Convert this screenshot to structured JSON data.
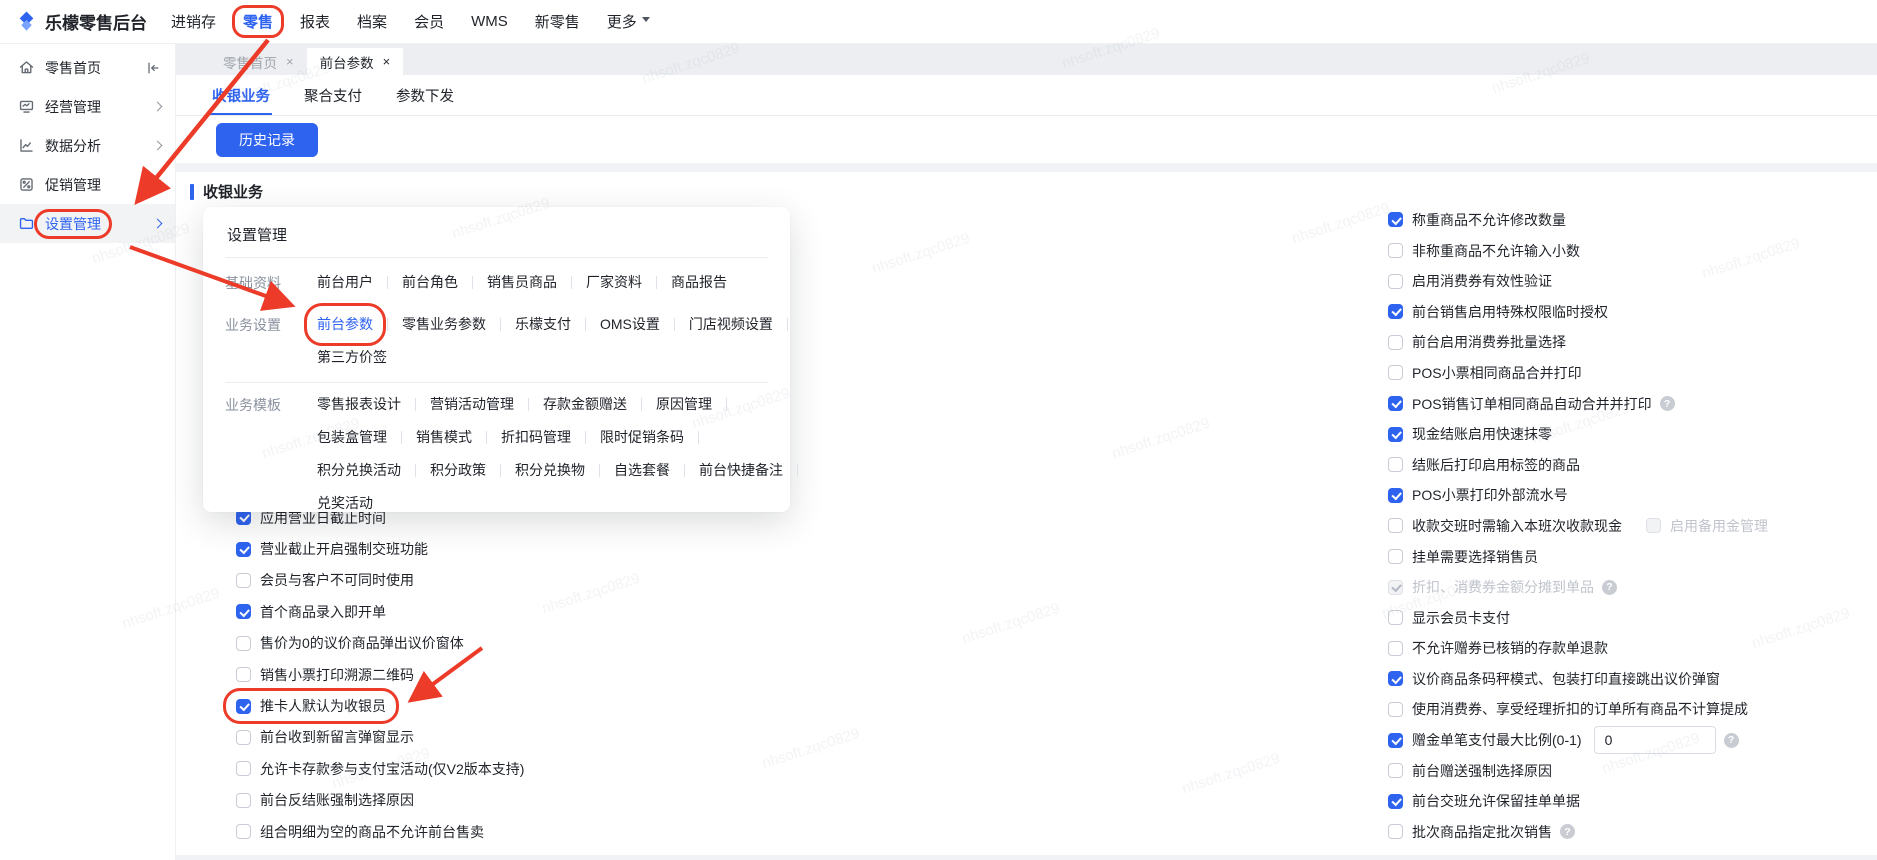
{
  "colors": {
    "accent": "#2e63f0",
    "annotation_red": "#ec3b28"
  },
  "watermark": "nhsoft.zqc0829",
  "topnav": {
    "brand": "乐檬零售后台",
    "items": [
      {
        "label": "进销存"
      },
      {
        "label": "零售",
        "active": true,
        "annotated": true
      },
      {
        "label": "报表"
      },
      {
        "label": "档案"
      },
      {
        "label": "会员"
      },
      {
        "label": "WMS"
      },
      {
        "label": "新零售"
      },
      {
        "label": "更多",
        "caret": true
      }
    ]
  },
  "sidebar": {
    "items": [
      {
        "label": "零售首页",
        "icon": "home",
        "collapse": true
      },
      {
        "label": "经营管理",
        "icon": "monitor",
        "chevron": true
      },
      {
        "label": "数据分析",
        "icon": "chart",
        "chevron": true
      },
      {
        "label": "促销管理",
        "icon": "promo",
        "chevron": true
      },
      {
        "label": "设置管理",
        "icon": "folder",
        "chevron": true,
        "selected": true,
        "annotated": true
      }
    ]
  },
  "tabs": [
    {
      "label": "零售首页",
      "close": "×",
      "active": false
    },
    {
      "label": "前台参数",
      "close": "×",
      "active": true
    }
  ],
  "subtabs": [
    {
      "label": "收银业务",
      "active": true
    },
    {
      "label": "聚合支付"
    },
    {
      "label": "参数下发"
    }
  ],
  "toolbar": {
    "history_button": "历史记录"
  },
  "section_title": "收银业务",
  "menu_panel": {
    "title": "设置管理",
    "groups": [
      {
        "label": "基础资料",
        "rows": [
          [
            "前台用户",
            "前台角色",
            "销售员商品",
            "厂家资料",
            "商品报告"
          ]
        ]
      },
      {
        "label": "业务设置",
        "highlight": "前台参数",
        "rows": [
          [
            "前台参数",
            "零售业务参数",
            "乐檬支付",
            "OMS设置",
            "门店视频设置"
          ],
          [
            "第三方价签"
          ]
        ]
      },
      {
        "label": "业务模板",
        "rows": [
          [
            "零售报表设计",
            "营销活动管理",
            "存款金额赠送",
            "原因管理"
          ],
          [
            "包装盒管理",
            "销售模式",
            "折扣码管理",
            "限时促销条码"
          ],
          [
            "积分兑换活动",
            "积分政策",
            "积分兑换物",
            "自选套餐",
            "前台快捷备注"
          ],
          [
            "兑奖活动"
          ]
        ]
      }
    ]
  },
  "left_params": [
    {
      "label": "应用营业日截止时间",
      "checked": true
    },
    {
      "label": "营业截止开启强制交班功能",
      "checked": true
    },
    {
      "label": "会员与客户不可同时使用",
      "checked": false
    },
    {
      "label": "首个商品录入即开单",
      "checked": true
    },
    {
      "label": "售价为0的议价商品弹出议价窗体",
      "checked": false
    },
    {
      "label": "销售小票打印溯源二维码",
      "checked": false
    },
    {
      "label": "推卡人默认为收银员",
      "checked": true,
      "annotated": true
    },
    {
      "label": "前台收到新留言弹窗显示",
      "checked": false
    },
    {
      "label": "允许卡存款参与支付宝活动(仅V2版本支持)",
      "checked": false
    },
    {
      "label": "前台反结账强制选择原因",
      "checked": false
    },
    {
      "label": "组合明细为空的商品不允许前台售卖",
      "checked": false
    }
  ],
  "right_params": [
    {
      "label": "称重商品不允许修改数量",
      "checked": true
    },
    {
      "label": "非称重商品不允许输入小数",
      "checked": false
    },
    {
      "label": "启用消费券有效性验证",
      "checked": false
    },
    {
      "label": "前台销售启用特殊权限临时授权",
      "checked": true
    },
    {
      "label": "前台启用消费券批量选择",
      "checked": false
    },
    {
      "label": "POS小票相同商品合并打印",
      "checked": false
    },
    {
      "label": "POS销售订单相同商品自动合并并打印",
      "checked": true,
      "help": true
    },
    {
      "label": "现金结账启用快速抹零",
      "checked": true
    },
    {
      "label": "结账后打印启用标签的商品",
      "checked": false
    },
    {
      "label": "POS小票打印外部流水号",
      "checked": true
    },
    {
      "label": "收款交班时需输入本班次收款现金",
      "checked": false,
      "extra": {
        "label": "启用备用金管理",
        "checked": false,
        "disabled": true
      }
    },
    {
      "label": "挂单需要选择销售员",
      "checked": false
    },
    {
      "label": "折扣、消费券金额分摊到单品",
      "checked": true,
      "disabled": true,
      "help": true
    },
    {
      "label": "显示会员卡支付",
      "checked": false
    },
    {
      "label": "不允许赠券已核销的存款单退款",
      "checked": false
    },
    {
      "label": "议价商品条码秤模式、包装打印直接跳出议价弹窗",
      "checked": true
    },
    {
      "label": "使用消费券、享受经理折扣的订单所有商品不计算提成",
      "checked": false
    },
    {
      "label": "赠金单笔支付最大比例(0-1)",
      "checked": true,
      "input": {
        "value": "0"
      },
      "help": true
    },
    {
      "label": "前台赠送强制选择原因",
      "checked": false
    },
    {
      "label": "前台交班允许保留挂单单据",
      "checked": true
    },
    {
      "label": "批次商品指定批次销售",
      "checked": false,
      "help": true
    }
  ]
}
